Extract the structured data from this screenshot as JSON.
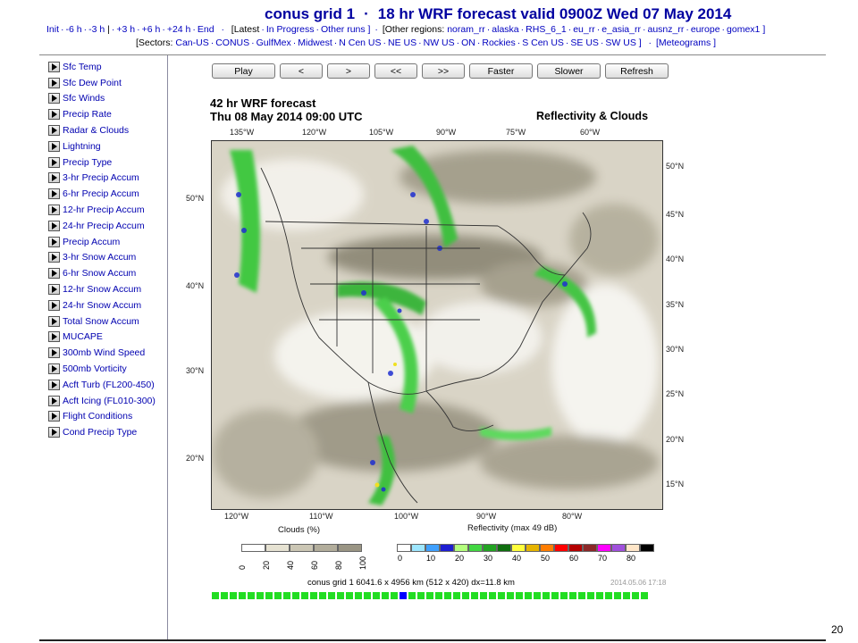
{
  "header": {
    "title_parts": [
      "conus grid 1",
      "·",
      "18 hr WRF forecast valid 0900Z Wed 07 May 2014"
    ],
    "row1_left": [
      "Init",
      "-6 h",
      "-3 h",
      "|",
      "+3 h",
      "+6 h",
      "+24 h",
      "End"
    ],
    "row1_mid": [
      "[Latest",
      "In Progress",
      "Other runs ]"
    ],
    "other_regions_label": "[Other regions:",
    "other_regions": [
      "noram_rr",
      "alaska",
      "RHS_6_1",
      "eu_rr",
      "e_asia_rr",
      "ausnz_rr",
      "europe",
      "gomex1 ]"
    ],
    "sectors_label": "[Sectors:",
    "sectors": [
      "Can-US",
      "CONUS",
      "GulfMex",
      "Midwest",
      "N Cen US",
      "NE US",
      "NW US",
      "ON",
      "Rockies",
      "S Cen US",
      "SE US",
      "SW US ]"
    ],
    "meteograms": "[Meteograms ]"
  },
  "sidebar": {
    "items": [
      "Sfc Temp",
      "Sfc Dew Point",
      "Sfc Winds",
      "Precip Rate",
      "Radar & Clouds",
      "Lightning",
      "Precip Type",
      "3-hr Precip Accum",
      "6-hr Precip Accum",
      "12-hr Precip Accum",
      "24-hr Precip Accum",
      "Precip Accum",
      "3-hr Snow Accum",
      "6-hr Snow Accum",
      "12-hr Snow Accum",
      "24-hr Snow Accum",
      "Total Snow Accum",
      "MUCAPE",
      "300mb Wind Speed",
      "500mb Vorticity",
      "Acft Turb (FL200-450)",
      "Acft Icing (FL010-300)",
      "Flight Conditions",
      "Cond Precip Type"
    ]
  },
  "controls": {
    "buttons": [
      "Play",
      "<",
      ">",
      "<<",
      ">>",
      "Faster",
      "Slower",
      "Refresh"
    ]
  },
  "forecast": {
    "title_line1": "42 hr WRF forecast",
    "title_line2": "Thu 08 May 2014 09:00 UTC",
    "product": "Reflectivity & Clouds",
    "top_lon_ticks": [
      "135°W",
      "120°W",
      "105°W",
      "90°W",
      "75°W",
      "60°W"
    ],
    "bottom_lon_ticks": [
      "120°W",
      "110°W",
      "100°W",
      "90°W",
      "80°W"
    ],
    "left_lat_ticks": [
      "50°N",
      "40°N",
      "30°N",
      "20°N"
    ],
    "right_lat_ticks": [
      "50°N",
      "45°N",
      "40°N",
      "35°N",
      "30°N",
      "25°N",
      "20°N",
      "15°N"
    ]
  },
  "legend": {
    "clouds_title": "Clouds (%)",
    "clouds_labels": [
      "0",
      "20",
      "40",
      "60",
      "80",
      "100"
    ],
    "clouds_colors": [
      "#ffffff",
      "#e6e2d2",
      "#cbc6b4",
      "#b2ad9b",
      "#9a9584"
    ],
    "refl_title": "Reflectivity (max 49 dB)",
    "refl_labels": [
      "0",
      "10",
      "20",
      "30",
      "40",
      "50",
      "60",
      "70",
      "80"
    ],
    "refl_colors": [
      "#ffffff",
      "#9ee7ff",
      "#3fa0ff",
      "#1e1ed2",
      "#b4ff7d",
      "#42d742",
      "#22a322",
      "#0f6e0f",
      "#ffff3c",
      "#e6b400",
      "#ff7d00",
      "#ff0000",
      "#b40000",
      "#8c2828",
      "#ff00ff",
      "#a050dc",
      "#ffe6c8",
      "#000000"
    ]
  },
  "info": {
    "text": "conus grid 1 6041.6 x 4956 km (512 x 420) dx=11.8 km",
    "stamp": "2014.05.06 17:18"
  },
  "animation": {
    "frame_count": 49,
    "current_index": 21
  },
  "slide_number": "20"
}
